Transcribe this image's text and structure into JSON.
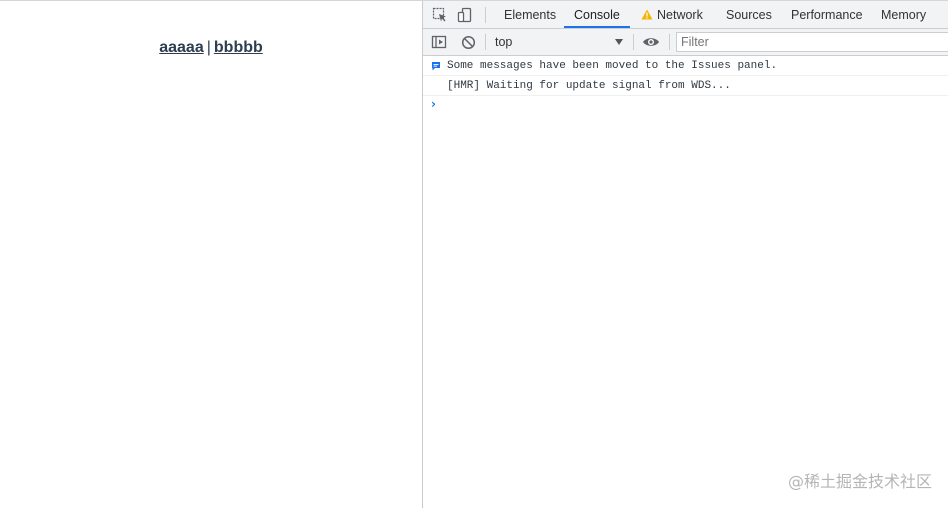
{
  "app": {
    "nav": {
      "link_a": "aaaaa",
      "separator": "|",
      "link_b": "bbbbb"
    }
  },
  "devtools": {
    "tabs": [
      {
        "label": "Elements",
        "active": false
      },
      {
        "label": "Console",
        "active": true
      },
      {
        "label": "Network",
        "active": false,
        "warning": true
      },
      {
        "label": "Sources",
        "active": false
      },
      {
        "label": "Performance",
        "active": false
      },
      {
        "label": "Memory",
        "active": false
      }
    ],
    "toolbar": {
      "context": "top",
      "filter_placeholder": "Filter"
    },
    "console": {
      "messages": [
        {
          "type": "info",
          "text": "Some messages have been moved to the Issues panel."
        },
        {
          "type": "log",
          "text": "[HMR] Waiting for update signal from WDS..."
        }
      ],
      "prompt": "›"
    },
    "colors": {
      "accent": "#1a73e8",
      "warning": "#f4b400",
      "link": "#2c3e50"
    }
  },
  "watermark": "@稀土掘金技术社区"
}
